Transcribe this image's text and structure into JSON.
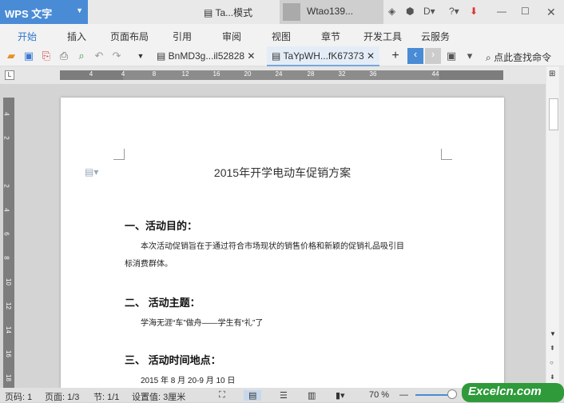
{
  "app": {
    "name": "WPS 文字",
    "doc_title": "Ta...模式",
    "user": "Wtao139..."
  },
  "menu": [
    "开始",
    "插入",
    "页面布局",
    "引用",
    "审阅",
    "视图",
    "章节",
    "开发工具",
    "云服务"
  ],
  "tabs": [
    {
      "label": "BnMD3g...il52828"
    },
    {
      "label": "TaYpWH...fK67373"
    }
  ],
  "search_label": "点此查找命令",
  "ruler": {
    "h": [
      "4",
      "4",
      "8",
      "12",
      "16",
      "20",
      "24",
      "28",
      "32",
      "36",
      "44"
    ],
    "v": [
      "4",
      "2",
      "2",
      "4",
      "6",
      "8",
      "10",
      "12",
      "14",
      "16",
      "18"
    ]
  },
  "document": {
    "title": "2015年开学电动车促销方案",
    "s1": "一、活动目的：",
    "p1a": "本次活动促销旨在于通过符合市场现状的销售价格和新颖的促销礼品吸引目",
    "p1b": "标消费群体。",
    "s2": "二、 活动主题：",
    "p2": "学海无涯“车”做舟——学生有“礼”了",
    "s3": "三、 活动时间地点：",
    "p3": "2015 年 8 月 20-9 月 10 日"
  },
  "status": {
    "page": "页码: 1",
    "pages": "页面: 1/3",
    "section": "节: 1/1",
    "setting": "设置值: 3厘米",
    "zoom": "70 %"
  },
  "watermark": "Excelcn.com"
}
